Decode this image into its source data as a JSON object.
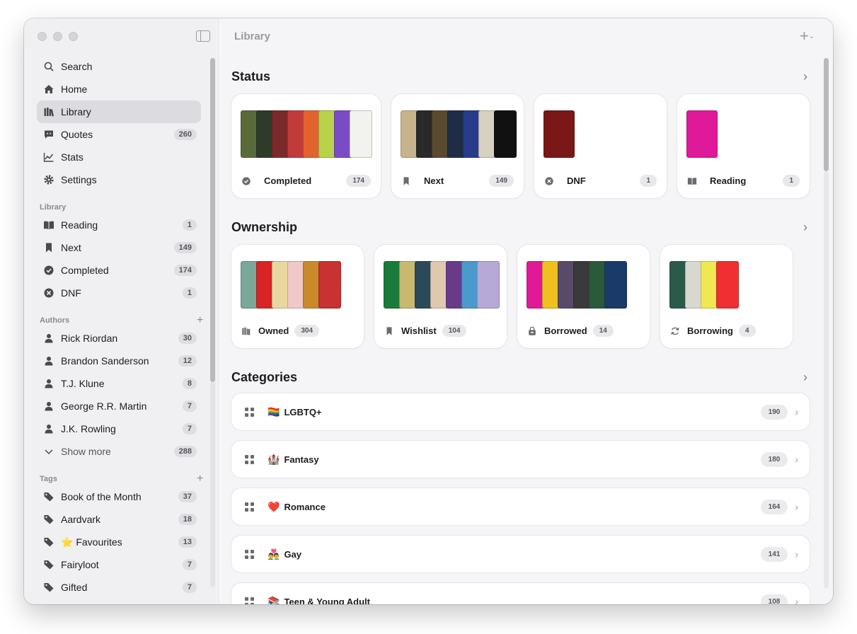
{
  "window": {
    "title": "Library"
  },
  "nav": [
    {
      "label": "Search",
      "icon": "search-icon",
      "count": null,
      "active": false
    },
    {
      "label": "Home",
      "icon": "home-icon",
      "count": null,
      "active": false
    },
    {
      "label": "Library",
      "icon": "library-icon",
      "count": null,
      "active": true
    },
    {
      "label": "Quotes",
      "icon": "quote-icon",
      "count": "260",
      "active": false
    },
    {
      "label": "Stats",
      "icon": "chart-icon",
      "count": null,
      "active": false
    },
    {
      "label": "Settings",
      "icon": "gear-icon",
      "count": null,
      "active": false
    }
  ],
  "library_section": {
    "heading": "Library",
    "items": [
      {
        "label": "Reading",
        "icon": "book-icon",
        "count": "1"
      },
      {
        "label": "Next",
        "icon": "bookmark-icon",
        "count": "149"
      },
      {
        "label": "Completed",
        "icon": "check-circle-icon",
        "count": "174"
      },
      {
        "label": "DNF",
        "icon": "x-circle-icon",
        "count": "1"
      }
    ]
  },
  "authors_section": {
    "heading": "Authors",
    "add": "+",
    "items": [
      {
        "label": "Rick Riordan",
        "count": "30"
      },
      {
        "label": "Brandon Sanderson",
        "count": "12"
      },
      {
        "label": "T.J. Klune",
        "count": "8"
      },
      {
        "label": "George R.R. Martin",
        "count": "7"
      },
      {
        "label": "J.K. Rowling",
        "count": "7"
      }
    ],
    "show_more": {
      "label": "Show more",
      "count": "288"
    }
  },
  "tags_section": {
    "heading": "Tags",
    "add": "+",
    "items": [
      {
        "label": "Book of the Month",
        "count": "37"
      },
      {
        "label": "Aardvark",
        "count": "18"
      },
      {
        "label": "⭐️ Favourites",
        "count": "13"
      },
      {
        "label": "Fairyloot",
        "count": "7"
      },
      {
        "label": "Gifted",
        "count": "7"
      }
    ]
  },
  "main": {
    "status": {
      "title": "Status",
      "cards": [
        {
          "label": "Completed",
          "count": "174",
          "icon": "check-circle-icon",
          "covers": [
            "#5a6b3a",
            "#2f3b2a",
            "#7a2a2a",
            "#c23b3b",
            "#e3632f",
            "#b8d24a",
            "#7b4bc6",
            "#f2f2ee"
          ]
        },
        {
          "label": "Next",
          "count": "149",
          "icon": "bookmark-icon",
          "covers": [
            "#c8b48a",
            "#2a2a2a",
            "#5a4a30",
            "#1f2d44",
            "#283b8c",
            "#d8d0c0",
            "#111111"
          ]
        },
        {
          "label": "DNF",
          "count": "1",
          "icon": "x-circle-icon",
          "covers": [
            "#7a1818"
          ]
        },
        {
          "label": "Reading",
          "count": "1",
          "icon": "book-icon",
          "covers": [
            "#e0199a"
          ]
        }
      ]
    },
    "ownership": {
      "title": "Ownership",
      "cards": [
        {
          "label": "Owned",
          "count": "304",
          "icon": "library-icon",
          "covers": [
            "#7aa89a",
            "#d82424",
            "#e8d8a0",
            "#f0c8c8",
            "#c98a2a",
            "#c83232"
          ]
        },
        {
          "label": "Wishlist",
          "count": "104",
          "icon": "bookmark-icon",
          "covers": [
            "#1a7a3a",
            "#c8b870",
            "#2a4a5a",
            "#e0c8b0",
            "#6a3a8a",
            "#4a9acb",
            "#b8a8d8"
          ]
        },
        {
          "label": "Borrowed",
          "count": "14",
          "icon": "lock-bag-icon",
          "covers": [
            "#e0199a",
            "#f0c020",
            "#5a4a6a",
            "#3a3a3a",
            "#2a5a3a",
            "#1a3a6a"
          ]
        },
        {
          "label": "Borrowing",
          "count": "4",
          "icon": "sync-icon",
          "covers": [
            "#2a5a4a",
            "#d8d8d0",
            "#f0e850",
            "#f03030"
          ]
        }
      ]
    },
    "categories": {
      "title": "Categories",
      "rows": [
        {
          "emoji": "🏳️‍🌈",
          "label": "LGBTQ+",
          "count": "190"
        },
        {
          "emoji": "🏰",
          "label": "Fantasy",
          "count": "180"
        },
        {
          "emoji": "❤️",
          "label": "Romance",
          "count": "164"
        },
        {
          "emoji": "👨‍❤️‍👨",
          "label": "Gay",
          "count": "141"
        },
        {
          "emoji": "📚",
          "label": "Teen & Young Adult",
          "count": "108"
        }
      ]
    }
  }
}
